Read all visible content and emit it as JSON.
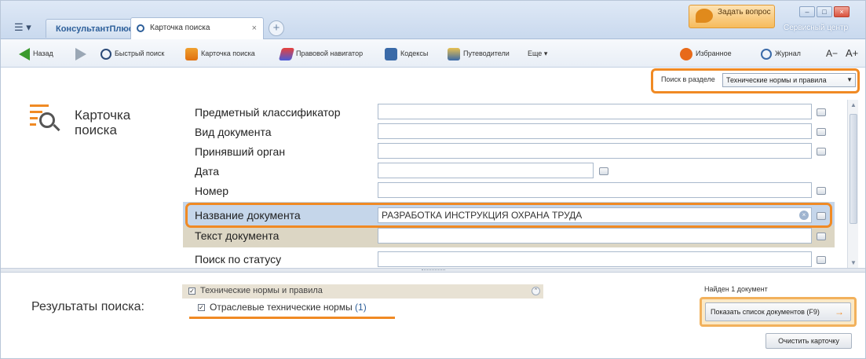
{
  "titlebar": {
    "menu_glyph": "☰ ▾",
    "app_tab": "КонсультантПлюс",
    "active_tab": "Карточка поиска",
    "tab_close": "×",
    "tab_add": "+",
    "ask_button": "Задать вопрос",
    "service_center": "Сервисный центр",
    "window_controls": [
      "–",
      "□",
      "×"
    ]
  },
  "toolbar": {
    "back": "Назад",
    "quick_search": "Быстрый поиск",
    "search_card": "Карточка поиска",
    "legal_navigator": "Правовой навигатор",
    "codes": "Кодексы",
    "guides": "Путеводители",
    "more": "Еще ▾",
    "favorites": "Избранное",
    "journal": "Журнал",
    "font_smaller": "A−",
    "font_larger": "A+"
  },
  "search_section": {
    "label": "Поиск в разделе",
    "value": "Технические нормы и правила"
  },
  "card": {
    "title": "Карточка поиска",
    "fields": [
      {
        "label": "Предметный классификатор",
        "value": ""
      },
      {
        "label": "Вид документа",
        "value": ""
      },
      {
        "label": "Принявший орган",
        "value": ""
      },
      {
        "label": "Дата",
        "value": ""
      },
      {
        "label": "Номер",
        "value": ""
      },
      {
        "label": "Название документа",
        "value": "РАЗРАБОТКА ИНСТРУКЦИЯ ОХРАНА ТРУДА"
      },
      {
        "label": "Текст документа",
        "value": ""
      },
      {
        "label": "Поиск по статусу",
        "value": ""
      }
    ]
  },
  "results": {
    "title": "Результаты поиска:",
    "group": "Технические нормы и правила",
    "group_checked": "✓",
    "subgroup": "Отраслевые технические нормы",
    "subgroup_count": "(1)",
    "found": "Найден 1 документ",
    "show_list_button": "Показать список документов (F9)",
    "clear_button": "Очистить карточку"
  },
  "colors": {
    "accent_orange": "#f08a24",
    "title_band": "#c5d6ea",
    "text_band": "#dcd6c4",
    "link_blue": "#2d5f9a"
  }
}
